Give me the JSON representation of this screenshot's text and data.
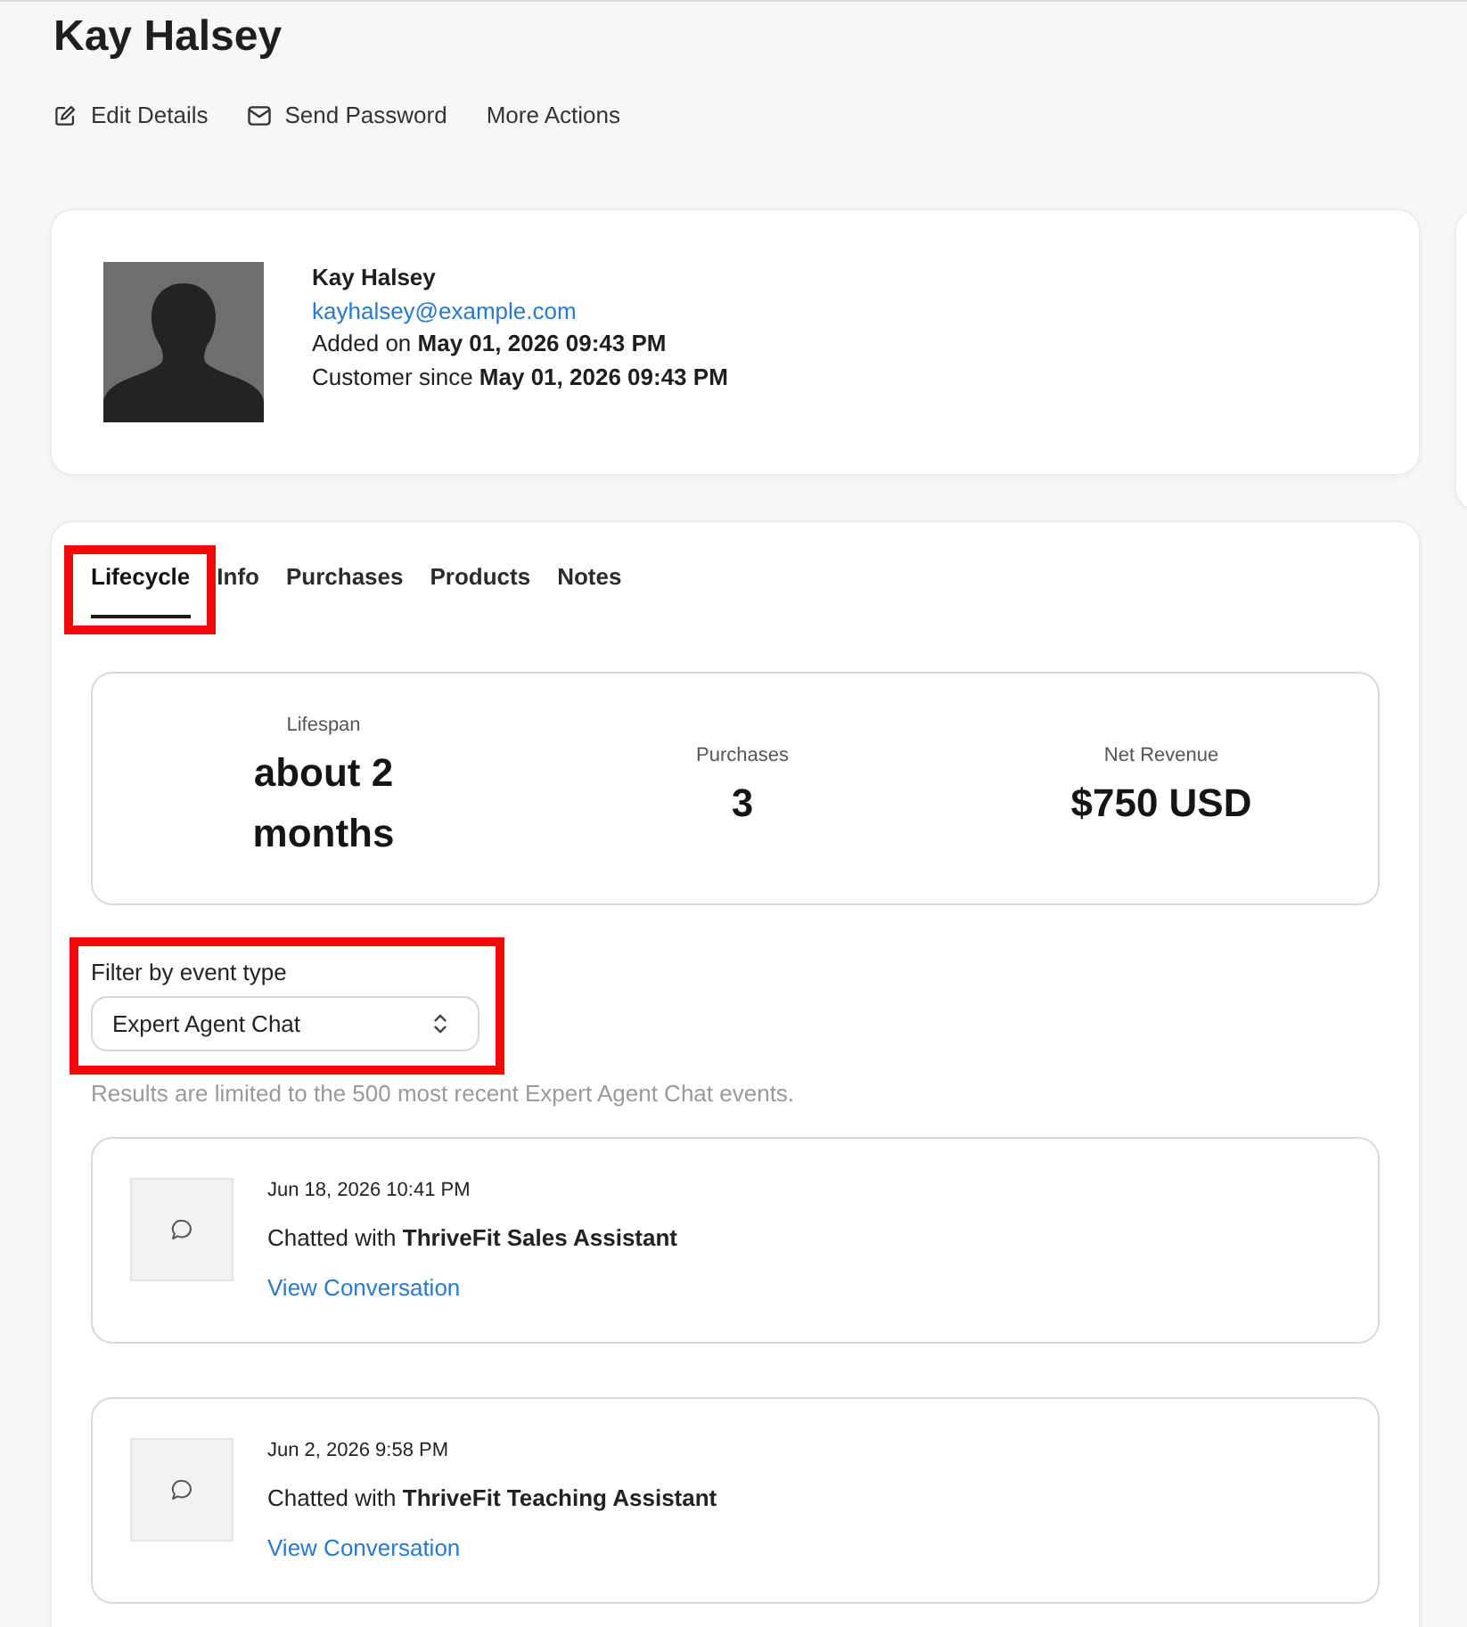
{
  "header": {
    "title": "Kay Halsey",
    "actions": [
      {
        "label": "Edit Details",
        "kind": "edit"
      },
      {
        "label": "Send Password",
        "kind": "mail"
      },
      {
        "label": "More Actions",
        "kind": "plain"
      }
    ]
  },
  "profile": {
    "name": "Kay Halsey",
    "email": "kayhalsey@example.com",
    "added": "Added on **May 01, 2026 09:43 PM**",
    "customer_since": "Customer since **May 01, 2026 09:43 PM**"
  },
  "tabs": [
    {
      "label": "Lifecycle",
      "selected": true,
      "highlighted": true
    },
    {
      "label": "Info",
      "selected": false,
      "highlighted": false
    },
    {
      "label": "Purchases",
      "selected": false,
      "highlighted": false
    },
    {
      "label": "Products",
      "selected": false,
      "highlighted": false
    },
    {
      "label": "Notes",
      "selected": false,
      "highlighted": false
    }
  ],
  "stats": [
    {
      "label": "Lifespan",
      "value": "about 2 months"
    },
    {
      "label": "Purchases",
      "value": "3"
    },
    {
      "label": "Net Revenue",
      "value": "$750 USD"
    }
  ],
  "filter": {
    "label": "Filter by event type",
    "value": "Expert Agent Chat",
    "highlighted": true
  },
  "filter_note": "Results are limited to the 500 most recent Expert Agent Chat events.",
  "events": [
    {
      "time": "Jun 18, 2026 10:41 PM",
      "text": "Chatted with **ThriveFit Sales Assistant**",
      "link": "View Conversation"
    },
    {
      "time": "Jun 2, 2026 9:58 PM",
      "text": "Chatted with **ThriveFit Teaching Assistant**",
      "link": "View Conversation"
    }
  ]
}
